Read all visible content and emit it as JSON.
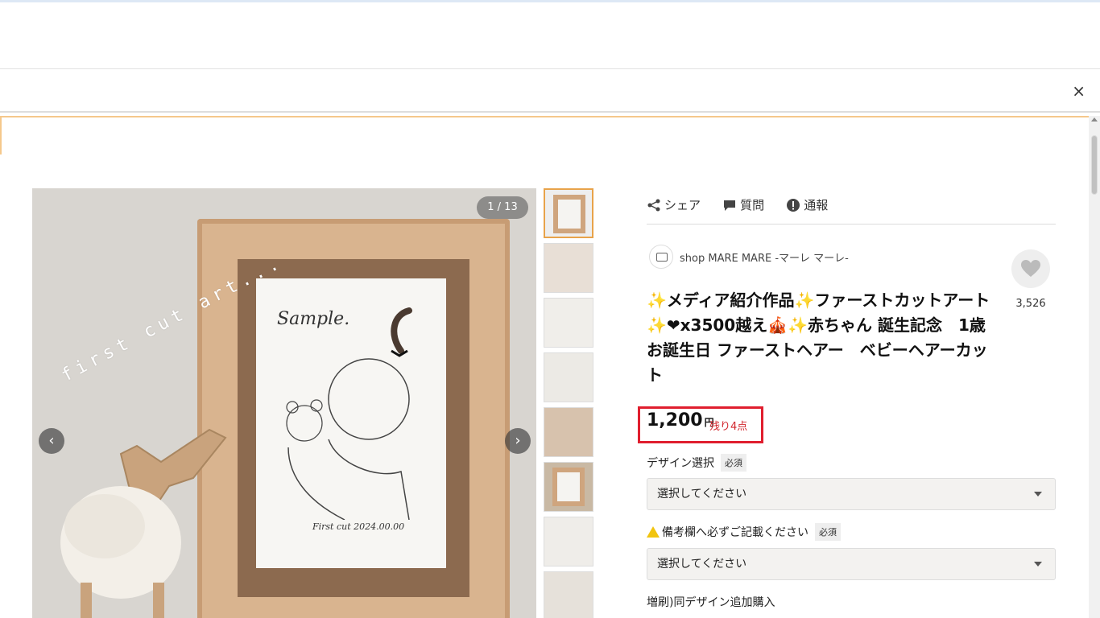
{
  "banner": {
    "close_label": "×"
  },
  "gallery": {
    "counter": "1 / 13",
    "overlay_text": "first cut art...",
    "sample_text": "Sample.",
    "caption": "First cut 2024.00.00",
    "prev_label": "‹",
    "next_label": "›",
    "thumbnail_count": 8
  },
  "actions": {
    "share": "シェア",
    "question": "質問",
    "report": "通報"
  },
  "shop": {
    "name": "shop MARE MARE -マーレ マーレ-"
  },
  "favorite": {
    "count": "3,526"
  },
  "product": {
    "title": "✨メディア紹介作品✨ファーストカットアート　✨❤x3500越え🎪✨赤ちゃん 誕生記念　1歳お誕生日 ファーストヘアー　ベビーヘアーカット",
    "price": "1,200",
    "currency": "円",
    "stock": "残り4点"
  },
  "options": {
    "design_label": "デザイン選択",
    "design_required": "必須",
    "design_placeholder": "選択してください",
    "notes_label": "備考欄へ必ずご記載ください",
    "notes_required": "必須",
    "notes_placeholder": "選択してください",
    "extra_label": "増刷)同デザイン追加購入"
  },
  "colors": {
    "accent_red": "#e01e2e",
    "stock_red": "#d2262d",
    "thumb_active": "#e8a34a"
  }
}
